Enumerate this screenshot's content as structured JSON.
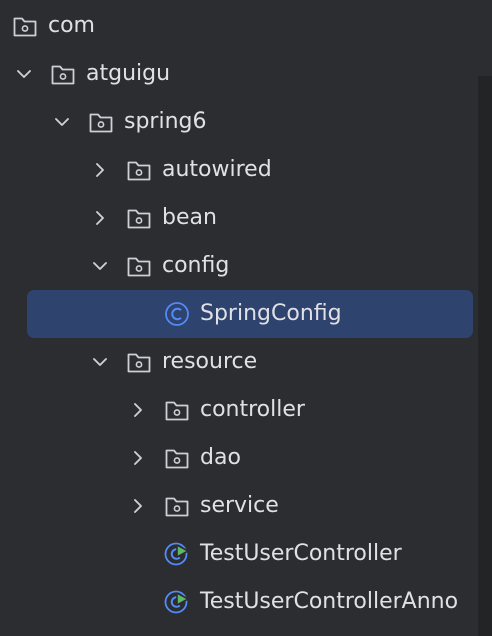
{
  "colors": {
    "background": "#2b2d30",
    "selection": "#2e436e",
    "text": "#dfe1e5",
    "folder_icon": "#ced0d6",
    "class_icon": "#548af7",
    "run_badge": "#5fb865"
  },
  "tree": {
    "nodes": [
      {
        "label": "com",
        "icon": "folder-icon",
        "expandable": false,
        "expanded": false,
        "selected": false
      },
      {
        "label": "atguigu",
        "icon": "folder-icon",
        "expandable": true,
        "expanded": true,
        "selected": false
      },
      {
        "label": "spring6",
        "icon": "folder-icon",
        "expandable": true,
        "expanded": true,
        "selected": false
      },
      {
        "label": "autowired",
        "icon": "folder-icon",
        "expandable": true,
        "expanded": false,
        "selected": false
      },
      {
        "label": "bean",
        "icon": "folder-icon",
        "expandable": true,
        "expanded": false,
        "selected": false
      },
      {
        "label": "config",
        "icon": "folder-icon",
        "expandable": true,
        "expanded": true,
        "selected": false
      },
      {
        "label": "SpringConfig",
        "icon": "class-icon",
        "expandable": false,
        "expanded": false,
        "selected": true
      },
      {
        "label": "resource",
        "icon": "folder-icon",
        "expandable": true,
        "expanded": true,
        "selected": false
      },
      {
        "label": "controller",
        "icon": "folder-icon",
        "expandable": true,
        "expanded": false,
        "selected": false
      },
      {
        "label": "dao",
        "icon": "folder-icon",
        "expandable": true,
        "expanded": false,
        "selected": false
      },
      {
        "label": "service",
        "icon": "folder-icon",
        "expandable": true,
        "expanded": false,
        "selected": false
      },
      {
        "label": "TestUserController",
        "icon": "test-class-icon",
        "expandable": false,
        "expanded": false,
        "selected": false
      },
      {
        "label": "TestUserControllerAnno",
        "icon": "test-class-icon",
        "expandable": false,
        "expanded": false,
        "selected": false
      }
    ]
  }
}
